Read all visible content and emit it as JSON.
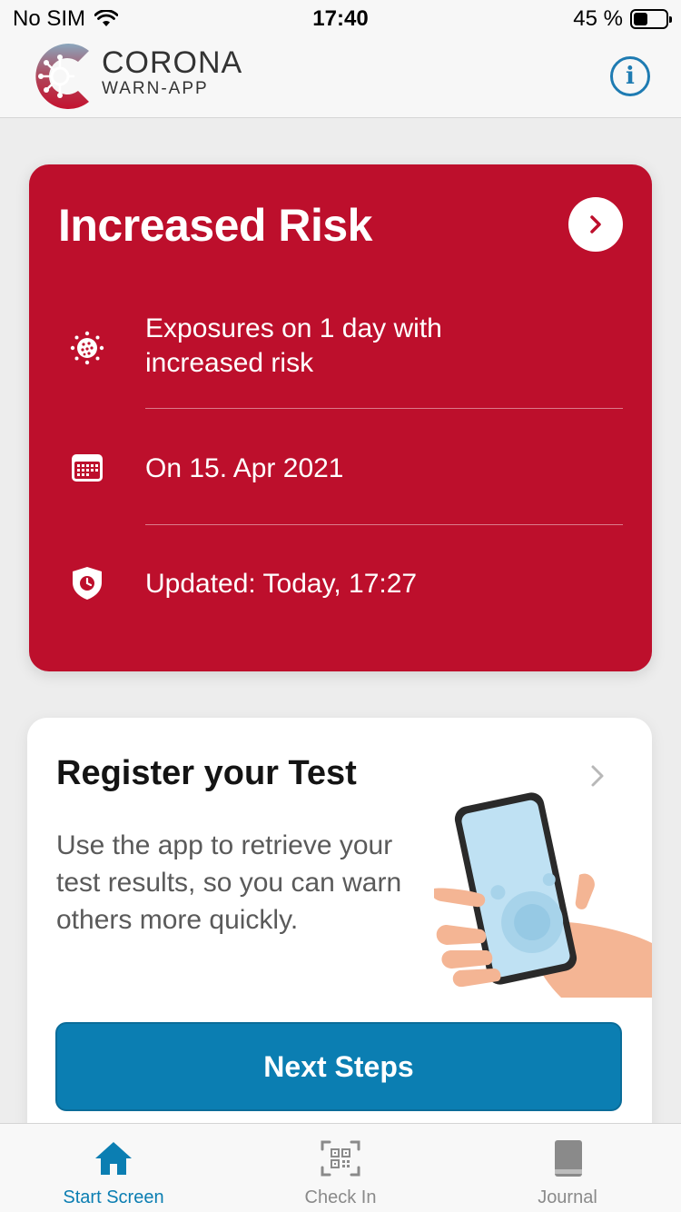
{
  "status_bar": {
    "carrier": "No SIM",
    "time": "17:40",
    "battery": "45 %",
    "battery_level": 0.45
  },
  "header": {
    "app_name_line1": "CORONA",
    "app_name_line2": "WARN-APP",
    "info_icon": "info-circle-icon"
  },
  "risk_card": {
    "title": "Increased Risk",
    "color": "#bd0f2c",
    "rows": [
      {
        "icon": "virus-icon",
        "text": "Exposures on 1 day with increased risk"
      },
      {
        "icon": "calendar-icon",
        "text": "On 15. Apr 2021"
      },
      {
        "icon": "shield-clock-icon",
        "text": "Updated: Today, 17:27"
      }
    ]
  },
  "test_card": {
    "title": "Register your Test",
    "description": "Use the app to retrieve your test results, so you can warn others more quickly.",
    "button_label": "Next Steps",
    "accent": "#0b7eb2"
  },
  "tab_bar": {
    "tabs": [
      {
        "label": "Start Screen",
        "icon": "home-icon",
        "active": true
      },
      {
        "label": "Check In",
        "icon": "qr-scan-icon",
        "active": false
      },
      {
        "label": "Journal",
        "icon": "book-icon",
        "active": false
      }
    ]
  }
}
